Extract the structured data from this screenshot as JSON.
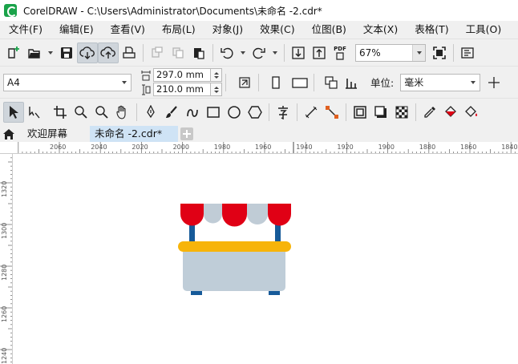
{
  "window": {
    "title": "CorelDRAW - C:\\Users\\Administrator\\Documents\\未命名 -2.cdr*"
  },
  "menu": {
    "items": [
      {
        "label": "文件(F)"
      },
      {
        "label": "编辑(E)"
      },
      {
        "label": "查看(V)"
      },
      {
        "label": "布局(L)"
      },
      {
        "label": "对象(J)"
      },
      {
        "label": "效果(C)"
      },
      {
        "label": "位图(B)"
      },
      {
        "label": "文本(X)"
      },
      {
        "label": "表格(T)"
      },
      {
        "label": "工具(O)"
      }
    ]
  },
  "standard_toolbar": {
    "zoom_value": "67%",
    "pdf_label": "PDF"
  },
  "property_bar": {
    "page_size": "A4",
    "width_value": "297.0 mm",
    "height_value": "210.0 mm",
    "unit_label": "单位:",
    "unit_value": "毫米"
  },
  "tabs": {
    "welcome_label": "欢迎屏幕",
    "current_label": "未命名 -2.cdr*"
  },
  "ruler_h": {
    "labels": [
      "2060",
      "2040",
      "2020",
      "2000",
      "1980",
      "1960",
      "1940",
      "1920",
      "1900",
      "1880",
      "1860",
      "1840"
    ],
    "unit": "米"
  },
  "ruler_v": {
    "labels": [
      "1320",
      "1300",
      "1280",
      "1260",
      "1240"
    ]
  },
  "colors": {
    "awning_red": "#e00015",
    "awning_grey": "#c0ccd6",
    "pole_blue": "#165a99",
    "counter_yellow": "#f7b40a",
    "stall_body": "#bfcdd8",
    "toolbar_bg": "#f0f0f0",
    "active_tab": "#cfe3f5"
  }
}
